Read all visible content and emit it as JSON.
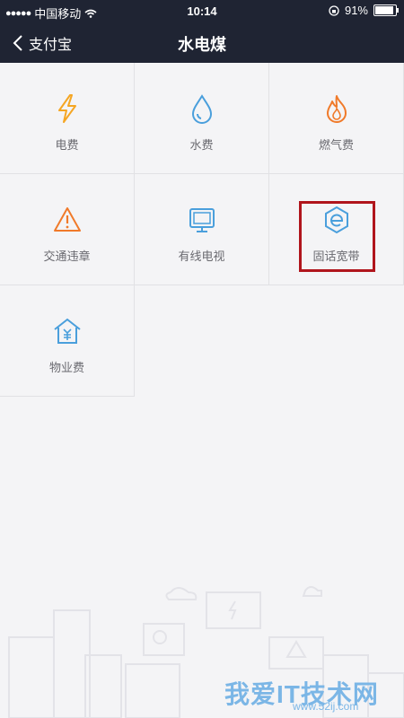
{
  "status": {
    "carrier": "中国移动",
    "time": "10:14",
    "battery": "91%",
    "battery_level": 0.91
  },
  "nav": {
    "back_label": "支付宝",
    "title": "水电煤"
  },
  "services": [
    {
      "label": "电费",
      "icon": "lightning-icon"
    },
    {
      "label": "水费",
      "icon": "water-drop-icon"
    },
    {
      "label": "燃气费",
      "icon": "flame-icon"
    },
    {
      "label": "交通违章",
      "icon": "warning-icon"
    },
    {
      "label": "有线电视",
      "icon": "tv-icon"
    },
    {
      "label": "固话宽带",
      "icon": "broadband-e-icon"
    },
    {
      "label": "物业费",
      "icon": "property-house-icon"
    }
  ],
  "watermark": {
    "text": "我爱IT技术网",
    "sub": "www.52ij.com"
  },
  "colors": {
    "navbar": "#1f2433",
    "background": "#f4f4f6",
    "highlight": "#b0151c",
    "orange": "#f5a623",
    "blue": "#4a9fdc"
  }
}
